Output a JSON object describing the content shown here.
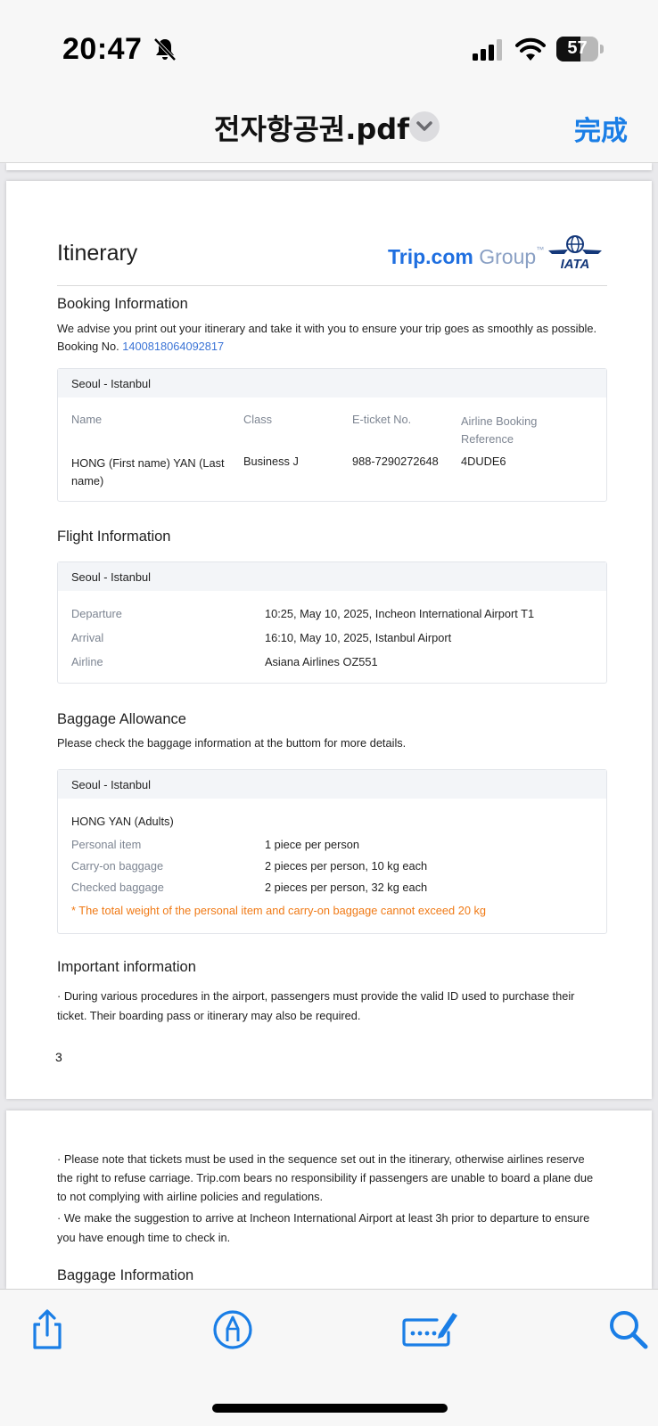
{
  "status": {
    "time": "20:47",
    "battery_level": "57",
    "battery_fraction": 0.57
  },
  "header": {
    "title": "전자항공권.pdf",
    "done_label": "完成"
  },
  "doc": {
    "title": "Itinerary",
    "logo": {
      "brand": "Trip.com",
      "group": "Group",
      "tm": "™",
      "iata": "IATA"
    },
    "booking": {
      "heading": "Booking Information",
      "advice": "We advise you print out your itinerary and take it with you to ensure your trip goes as smoothly as possible.",
      "booking_no_label": "Booking No.",
      "booking_no": "1400818064092817",
      "route": "Seoul - Istanbul",
      "columns": [
        "Name",
        "Class",
        "E-ticket No.",
        "Airline Booking Reference"
      ],
      "row": {
        "name": "HONG (First name) YAN (Last name)",
        "class": "Business J",
        "eticket": "988-7290272648",
        "reference": "4DUDE6"
      }
    },
    "flight": {
      "heading": "Flight Information",
      "route": "Seoul - Istanbul",
      "rows": [
        {
          "label": "Departure",
          "value": "10:25, May 10, 2025, Incheon International Airport T1"
        },
        {
          "label": "Arrival",
          "value": "16:10, May 10, 2025, Istanbul Airport"
        },
        {
          "label": "Airline",
          "value": "Asiana Airlines OZ551"
        }
      ]
    },
    "baggage": {
      "heading": "Baggage Allowance",
      "note": "Please check the baggage information at the buttom for more details.",
      "route": "Seoul - Istanbul",
      "passenger": "HONG YAN (Adults)",
      "rows": [
        {
          "label": "Personal item",
          "value": "1 piece per person"
        },
        {
          "label": "Carry-on baggage",
          "value": "2 pieces per person, 10 kg each"
        },
        {
          "label": "Checked baggage",
          "value": "2 pieces per person, 32 kg each"
        }
      ],
      "warning": "* The total weight of the personal item and carry-on baggage cannot exceed 20 kg"
    },
    "important": {
      "heading": "Important information",
      "line1": "· During various procedures in the airport, passengers must provide the valid ID used to purchase their ticket. Their boarding pass or itinerary may also be required."
    },
    "page_number": "3",
    "page2": {
      "line2": "· Please note that tickets must be used in the sequence set out in the itinerary, otherwise airlines reserve the right to refuse carriage. Trip.com bears no responsibility if passengers are unable to board a plane due to not complying with airline policies and regulations.",
      "line3": "· We make the suggestion to arrive at Incheon International Airport at least 3h prior to departure to ensure you have enough time to check in.",
      "next_heading": "Baggage Information"
    }
  },
  "toolbar": [
    "share-icon",
    "markup-icon",
    "fill-sign-icon",
    "search-icon"
  ],
  "colors": {
    "accent": "#1a7ee6",
    "link": "#3b74d6",
    "warning": "#f07a16"
  }
}
